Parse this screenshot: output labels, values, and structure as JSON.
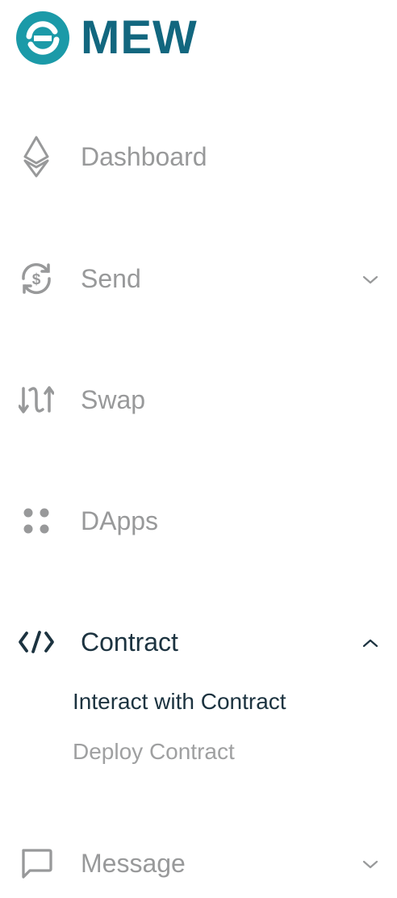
{
  "brand": {
    "name": "MEW",
    "color": "#12677f",
    "accent": "#2aa5b5"
  },
  "nav": {
    "dashboard": {
      "label": "Dashboard",
      "icon": "ethereum-icon"
    },
    "send": {
      "label": "Send",
      "icon": "dollar-cycle-icon",
      "expanded": false
    },
    "swap": {
      "label": "Swap",
      "icon": "swap-arrows-icon"
    },
    "dapps": {
      "label": "DApps",
      "icon": "dots-grid-icon"
    },
    "contract": {
      "label": "Contract",
      "icon": "code-icon",
      "expanded": true,
      "sub": [
        {
          "label": "Interact with Contract",
          "active": true
        },
        {
          "label": "Deploy Contract",
          "active": false
        }
      ]
    },
    "message": {
      "label": "Message",
      "icon": "chat-bubble-icon",
      "expanded": false
    }
  },
  "colors": {
    "inactive": "#98999a",
    "active": "#1c3340"
  }
}
